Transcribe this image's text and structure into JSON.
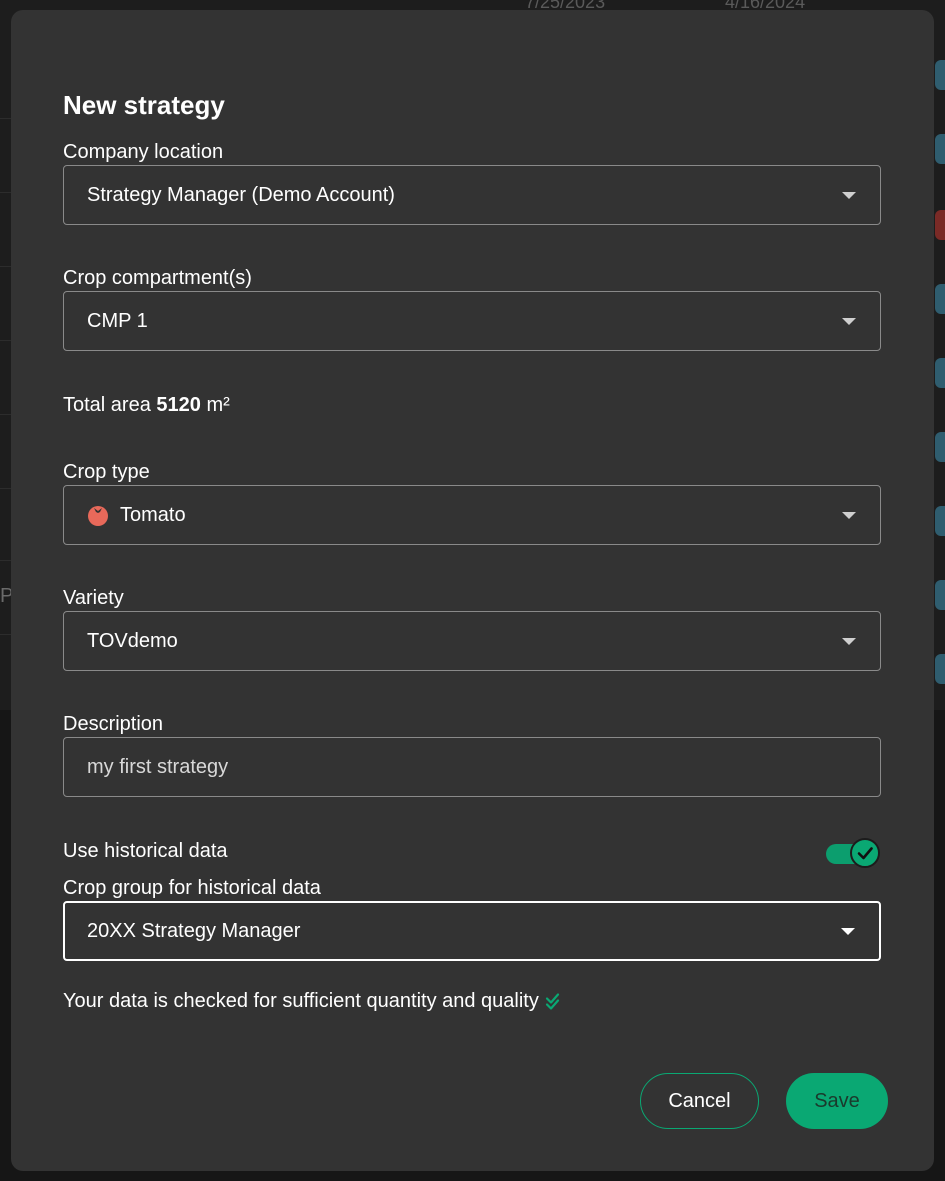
{
  "background": {
    "dates": [
      "7/25/2023",
      "4/16/2024"
    ],
    "partial_letter": "P"
  },
  "modal": {
    "title": "New strategy",
    "company_location": {
      "label": "Company location",
      "value": "Strategy Manager (Demo Account)"
    },
    "crop_compartments": {
      "label": "Crop compartment(s)",
      "value": "CMP 1"
    },
    "total_area": {
      "label": "Total area",
      "value": "5120",
      "unit": "m²"
    },
    "crop_type": {
      "label": "Crop type",
      "value": "Tomato",
      "icon": "tomato-icon",
      "icon_color": "#e8695a"
    },
    "variety": {
      "label": "Variety",
      "value": "TOVdemo"
    },
    "description": {
      "label": "Description",
      "value": "my first strategy"
    },
    "historical": {
      "label": "Use historical data",
      "enabled": true
    },
    "crop_group": {
      "label": "Crop group for historical data",
      "value": "20XX Strategy Manager"
    },
    "quality_message": "Your data is checked for sufficient quantity and quality",
    "buttons": {
      "cancel": "Cancel",
      "save": "Save"
    }
  },
  "colors": {
    "accent": "#0aa873",
    "modal_bg": "#333333",
    "text": "#ffffff"
  }
}
